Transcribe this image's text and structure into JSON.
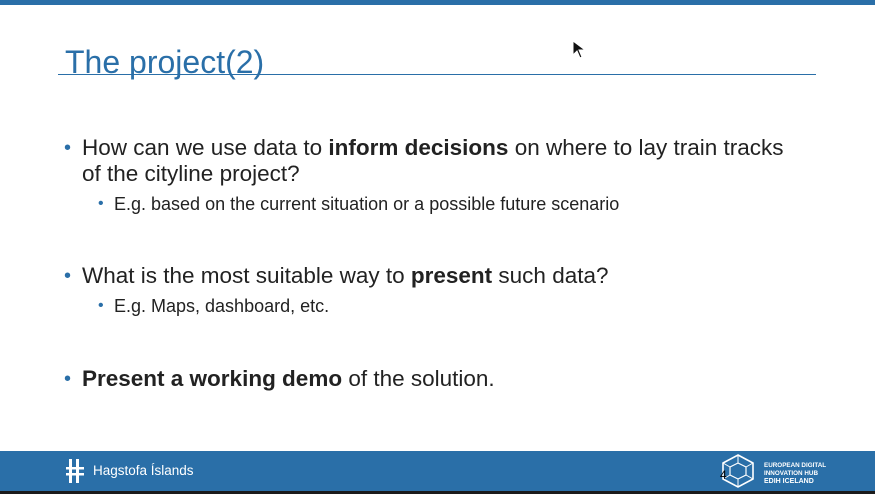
{
  "slide": {
    "title": "The project(2)",
    "page_number": "4"
  },
  "bullets": [
    {
      "before": "How can we use data to ",
      "bold": "inform decisions",
      "after": " on where to lay train tracks",
      "line2": "of the cityline project?",
      "sub": "E.g. based on the current situation or a possible future scenario"
    },
    {
      "before": "What is the most suitable way to ",
      "bold": "present",
      "after": " such data?",
      "sub": "E.g. Maps, dashboard, etc."
    },
    {
      "bold": "Present a working demo",
      "after": " of the solution."
    }
  ],
  "footer": {
    "org_name": "Hagstofa Íslands",
    "edih_line1": "EUROPEAN DIGITAL",
    "edih_line2": "INNOVATION HUB",
    "edih_line3": "EDIH ICELAND"
  },
  "colors": {
    "accent": "#2a6fa8",
    "text": "#222222"
  },
  "icons": {
    "cursor": "mouse-pointer-icon",
    "org_logo": "hagstofa-logo-icon",
    "edih_logo": "edih-cube-logo-icon"
  }
}
